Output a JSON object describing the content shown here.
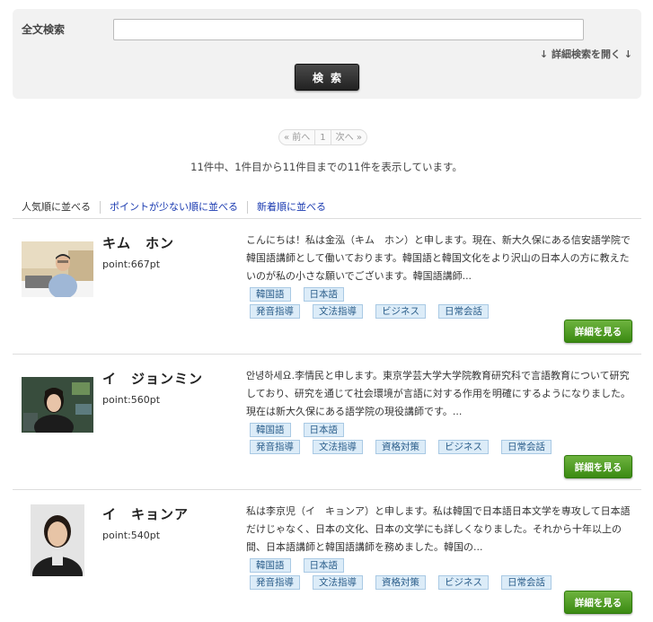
{
  "search": {
    "label": "全文検索",
    "value": "",
    "placeholder": "",
    "advanced_link": "↓ 詳細検索を開く ↓",
    "button_label": "検索"
  },
  "pager": {
    "prev": "« 前へ",
    "current": "1",
    "next": "次へ »"
  },
  "result_count": "11件中、1件目から11件目までの11件を表示しています。",
  "sort": {
    "popular": "人気順に並べる",
    "low_points": "ポイントが少ない順に並べる",
    "newest": "新着順に並べる"
  },
  "teachers": [
    {
      "name": "キム　ホン",
      "point": "point:667pt",
      "desc": "こんにちは！私は金泓（キム　ホン）と申します。現在、新大久保にある信安語学院で韓国語講師として働いております。韓国語と韓国文化をより沢山の日本人の方に教えたいのが私の小さな願いでございます。韓国語講師...",
      "tags_row1": [
        "韓国語",
        "日本語"
      ],
      "tags_row2": [
        "発音指導",
        "文法指導",
        "ビジネス",
        "日常会話"
      ],
      "detail_label": "詳細を見る"
    },
    {
      "name": "イ　ジョンミン",
      "point": "point:560pt",
      "desc": "안녕하세요.李情民と申します。東京学芸大学大学院教育研究科で言語教育について研究しており、研究を通じて社会環境が言語に対する作用を明確にするようになりました。現在は新大久保にある語学院の現役講師です。...",
      "tags_row1": [
        "韓国語",
        "日本語"
      ],
      "tags_row2": [
        "発音指導",
        "文法指導",
        "資格対策",
        "ビジネス",
        "日常会話"
      ],
      "detail_label": "詳細を見る"
    },
    {
      "name": "イ　キョンア",
      "point": "point:540pt",
      "desc": "私は李京児（イ　キョンア）と申します。私は韓国で日本語日本文学を専攻して日本語だけじゃなく、日本の文化、日本の文学にも詳しくなりました。それから十年以上の間、日本語講師と韓国語講師を務めました。韓国の...",
      "tags_row1": [
        "韓国語",
        "日本語"
      ],
      "tags_row2": [
        "発音指導",
        "文法指導",
        "資格対策",
        "ビジネス",
        "日常会話"
      ],
      "detail_label": "詳細を見る"
    }
  ],
  "colors": {
    "panel_bg": "#f2f2f2",
    "link": "#1a3ab0",
    "tag_bg": "#dcecf8",
    "tag_text": "#2a5d8a",
    "detail_button": "#4a9a22",
    "search_button": "#333333"
  }
}
